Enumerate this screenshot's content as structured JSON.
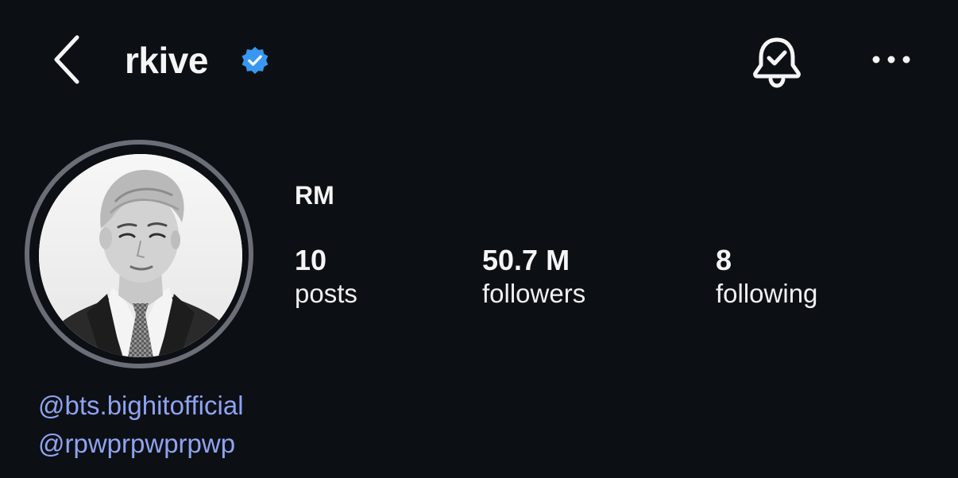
{
  "header": {
    "username": "rkive",
    "icons": {
      "back": "chevron-left-icon",
      "verified": "verified-badge-icon",
      "notifications": "bell-check-icon",
      "more": "more-horizontal-icon"
    }
  },
  "profile": {
    "display_name": "RM",
    "stats": [
      {
        "value": "10",
        "label": "posts"
      },
      {
        "value": "50.7 M",
        "label": "followers"
      },
      {
        "value": "8",
        "label": "following"
      }
    ],
    "bio_links": [
      "@bts.bighitofficial",
      "@rpwprpwprpwp"
    ]
  },
  "colors": {
    "background": "#0c0f14",
    "text": "#f5f5f5",
    "verified": "#3897f0",
    "link": "#8fa3f0",
    "avatar_ring": "#6b6e76"
  }
}
